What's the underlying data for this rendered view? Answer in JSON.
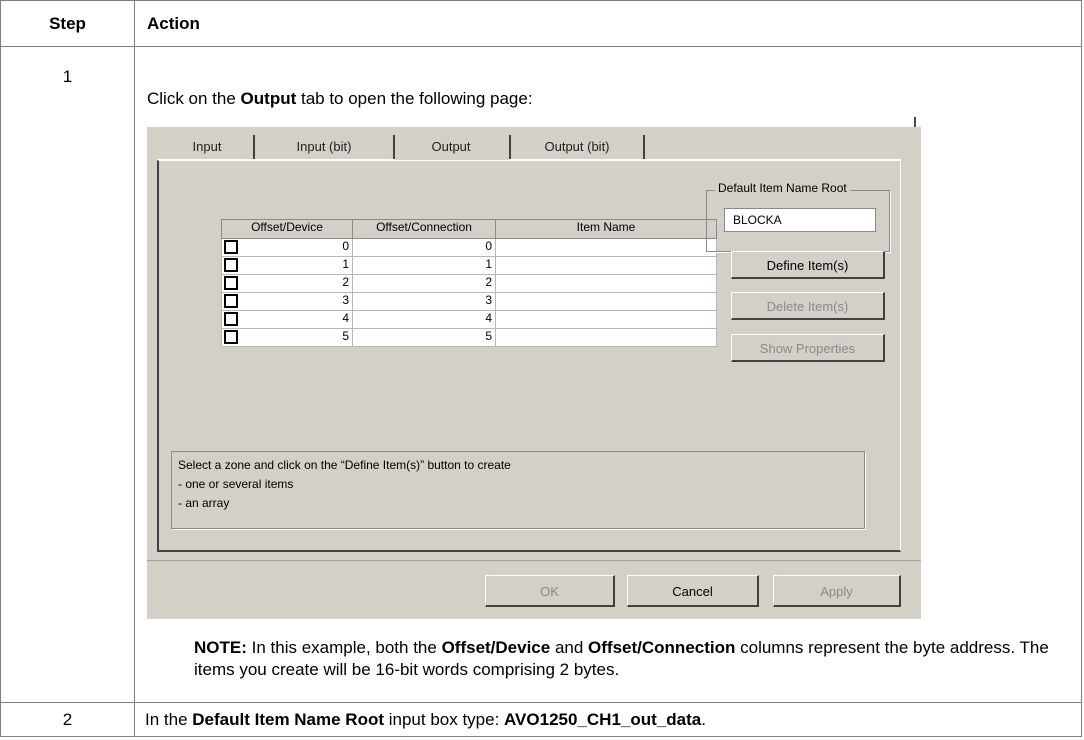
{
  "table": {
    "header_step": "Step",
    "header_action": "Action",
    "rows": [
      {
        "step": "1",
        "intro_prefix": "Click on the ",
        "intro_bold": "Output",
        "intro_suffix": " tab to open the following page:",
        "note_label": "NOTE:",
        "note_part1": " In this example, both the ",
        "note_bold1": "Offset/Device",
        "note_part2": " and ",
        "note_bold2": "Offset/Connection",
        "note_part3": " columns represent the byte address. The items you create will be 16-bit words comprising 2 bytes."
      },
      {
        "step": "2",
        "text_prefix": "In the ",
        "text_bold1": "Default Item Name Root",
        "text_middle": " input box type: ",
        "text_bold2": "AVO1250_CH1_out_data",
        "text_suffix": "."
      }
    ]
  },
  "dialog": {
    "tabs": [
      "Input",
      "Input (bit)",
      "Output",
      "Output (bit)"
    ],
    "active_tab": "Output",
    "grid": {
      "columns": [
        "Offset/Device",
        "Offset/Connection",
        "Item Name"
      ],
      "rows": [
        {
          "device": "0",
          "connection": "0",
          "item": ""
        },
        {
          "device": "1",
          "connection": "1",
          "item": ""
        },
        {
          "device": "2",
          "connection": "2",
          "item": ""
        },
        {
          "device": "3",
          "connection": "3",
          "item": ""
        },
        {
          "device": "4",
          "connection": "4",
          "item": ""
        },
        {
          "device": "5",
          "connection": "5",
          "item": ""
        }
      ]
    },
    "default_name_group": "Default Item Name Root",
    "default_name_value": "BLOCKA",
    "buttons": {
      "define": "Define Item(s)",
      "delete": "Delete Item(s)",
      "show_properties": "Show Properties",
      "ok": "OK",
      "cancel": "Cancel",
      "apply": "Apply"
    },
    "hint_lines": [
      "Select a zone and click on the “Define Item(s)” button to create",
      "- one or several items",
      "- an array"
    ]
  }
}
